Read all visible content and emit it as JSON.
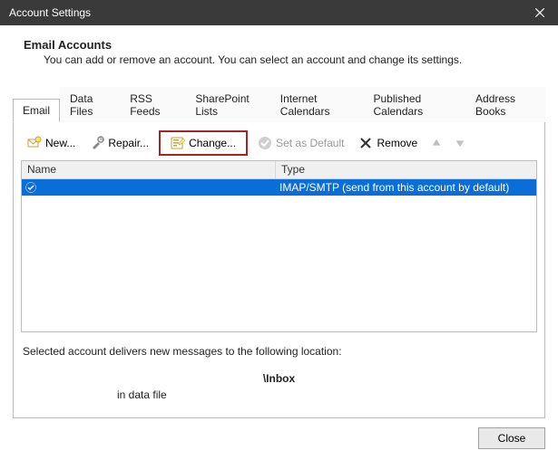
{
  "window": {
    "title": "Account Settings"
  },
  "header": {
    "title": "Email Accounts",
    "desc": "You can add or remove an account. You can select an account and change its settings."
  },
  "tabs": [
    "Email",
    "Data Files",
    "RSS Feeds",
    "SharePoint Lists",
    "Internet Calendars",
    "Published Calendars",
    "Address Books"
  ],
  "toolbar": {
    "new_label": "New...",
    "repair_label": "Repair...",
    "change_label": "Change...",
    "set_default_label": "Set as Default",
    "remove_label": "Remove"
  },
  "table": {
    "headers": {
      "name": "Name",
      "type": "Type"
    },
    "rows": [
      {
        "name": "",
        "type": "IMAP/SMTP (send from this account by default)"
      }
    ]
  },
  "lower": {
    "msg": "Selected account delivers new messages to the following location:",
    "location": "\\Inbox",
    "datafile": "in data file"
  },
  "footer": {
    "close_label": "Close"
  }
}
